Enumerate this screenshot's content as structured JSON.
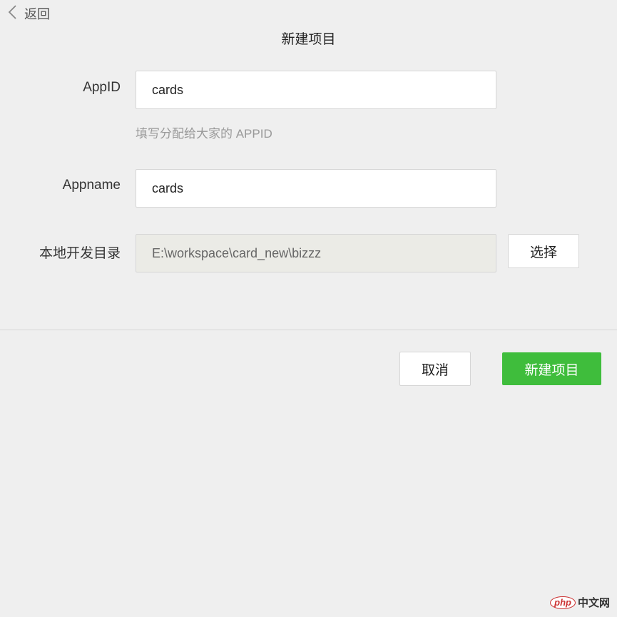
{
  "nav": {
    "back_label": "返回"
  },
  "page": {
    "title": "新建项目"
  },
  "form": {
    "appid": {
      "label": "AppID",
      "value": "cards",
      "hint": "填写分配给大家的 APPID"
    },
    "appname": {
      "label": "Appname",
      "value": "cards"
    },
    "directory": {
      "label": "本地开发目录",
      "value": "E:\\workspace\\card_new\\bizzz",
      "browse_label": "选择"
    }
  },
  "footer": {
    "cancel_label": "取消",
    "create_label": "新建项目"
  },
  "watermark": {
    "logo": "php",
    "text": "中文网"
  },
  "colors": {
    "primary": "#3fbd3c",
    "background": "#efefef"
  }
}
